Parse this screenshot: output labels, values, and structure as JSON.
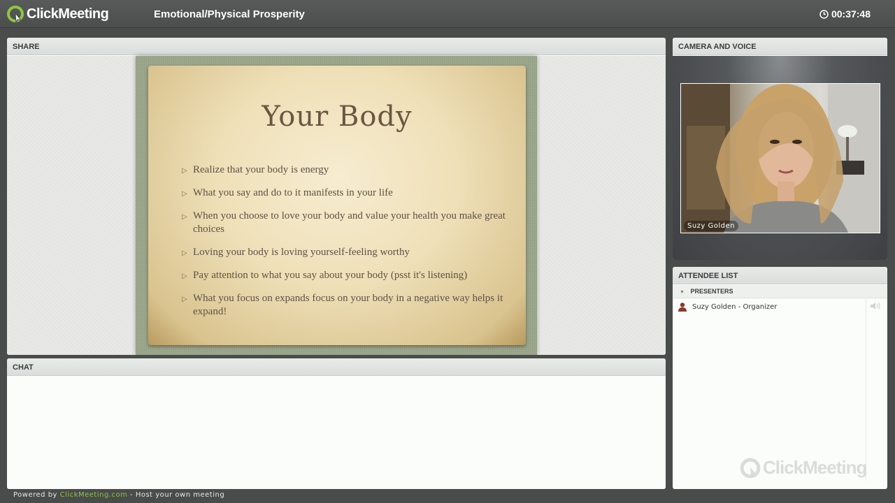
{
  "app": {
    "brand": "ClickMeeting",
    "meeting_title": "Emotional/Physical Prosperity",
    "timer": "00:37:48",
    "accent_color": "#8dc63f"
  },
  "share": {
    "header": "SHARE",
    "slide": {
      "title": "Your Body",
      "bullets": [
        "Realize that your body is energy",
        "What you say and do to it manifests in your life",
        "When you choose to love your body and value your health you make great choices",
        "Loving your body is loving yourself-feeling worthy",
        "Pay attention to what you say about your body (psst it's listening)",
        "What you focus on expands focus on your body in a negative way helps it expand!"
      ]
    }
  },
  "chat": {
    "header": "CHAT"
  },
  "camera": {
    "header": "CAMERA AND VOICE",
    "video_label": "Suzy Golden"
  },
  "attendees": {
    "header": "ATTENDEE LIST",
    "group_label": "PRESENTERS",
    "items": [
      {
        "label": "Suzy Golden - Organizer"
      }
    ],
    "watermark": "ClickMeeting"
  },
  "footer": {
    "prefix": "Powered by",
    "link": "ClickMeeting.com",
    "suffix": "- Host your own meeting"
  }
}
